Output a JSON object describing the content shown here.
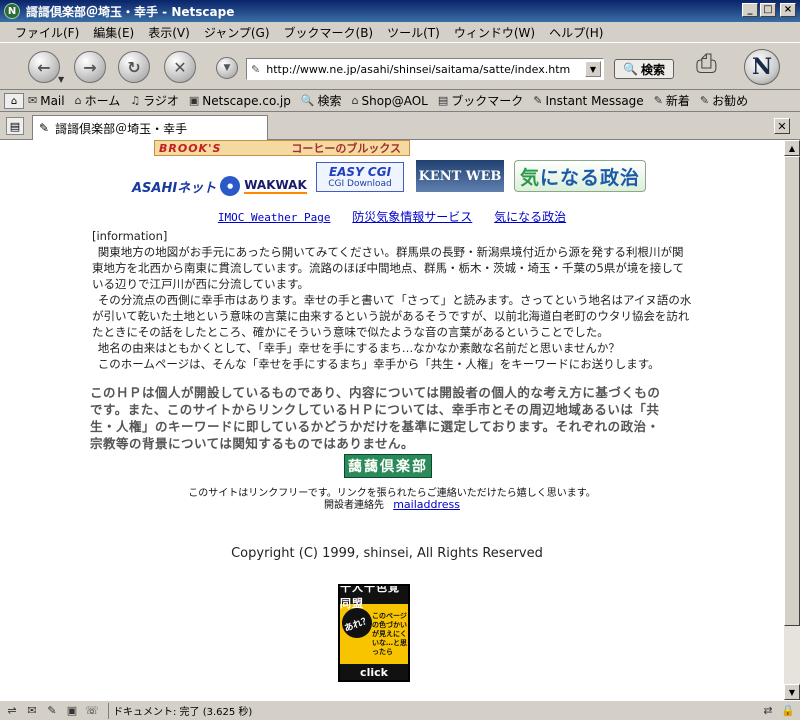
{
  "window": {
    "title": "謌謌倶楽部＠埼玉・幸手 - Netscape",
    "app_icon": "N",
    "minimize": "_",
    "maximize": "□",
    "close": "×"
  },
  "menu": [
    "ファイル(F)",
    "編集(E)",
    "表示(V)",
    "ジャンプ(G)",
    "ブックマーク(B)",
    "ツール(T)",
    "ウィンドウ(W)",
    "ヘルプ(H)"
  ],
  "nav": {
    "url": "http://www.ne.jp/asahi/shinsei/saitama/satte/index.htm",
    "search_label": "検索"
  },
  "personal_toolbar": [
    {
      "icon": "✉",
      "label": "Mail"
    },
    {
      "icon": "⌂",
      "label": "ホーム"
    },
    {
      "icon": "♫",
      "label": "ラジオ"
    },
    {
      "icon": "▣",
      "label": "Netscape.co.jp"
    },
    {
      "icon": "🔍",
      "label": "検索"
    },
    {
      "icon": "⌂",
      "label": "Shop@AOL"
    },
    {
      "icon": "▤",
      "label": "ブックマーク"
    },
    {
      "icon": "✎",
      "label": "Instant Message"
    },
    {
      "icon": "✎",
      "label": "新着"
    },
    {
      "icon": "✎",
      "label": "お勧め"
    }
  ],
  "tab": {
    "label": "謌謌倶楽部＠埼玉・幸手"
  },
  "page": {
    "top_banner_brand": "BROOK'S",
    "top_banner_text": "コーヒーのブルックス",
    "logo_asahi": "ASAHIネット",
    "logo_wakwak": "WAKWAK",
    "badge_easy_cgi": "EASY CGI",
    "badge_easy_cgi_sub": "CGI Download",
    "badge_kent": "KENT WEB",
    "badge_kininaru_kana": "気",
    "badge_kininaru_rest": "になる政治",
    "links": [
      "IMOC Weather Page",
      "防災気象情報サービス",
      "気になる政治"
    ],
    "info_head": "[information]",
    "info_paragraphs": [
      "関東地方の地図がお手元にあったら開いてみてください。群馬県の長野・新潟県境付近から源を発する利根川が関東地方を北西から南東に貫流しています。流路のほぼ中間地点、群馬・栃木・茨城・埼玉・千葉の5県が境を接している辺りで江戸川が西に分流しています。",
      "その分流点の西側に幸手市はあります。幸せの手と書いて「さって」と読みます。さってという地名はアイヌ語の水が引いて乾いた土地という意味の言葉に由来するという説があるそうですが、以前北海道白老町のウタリ協会を訪れたときにその話をしたところ、確かにそういう意味で似たような音の言葉があるということでした。",
      "地名の由来はともかくとして、「幸手」幸せを手にするまち…なかなか素敵な名前だと思いませんか？",
      "このホームページは、そんな「幸せを手にするまち」幸手から「共生・人権」をキーワードにお送りします。"
    ],
    "disclaimer": "このＨＰは個人が開設しているものであり、内容については開設者の個人的な考え方に基づくものです。また、このサイトからリンクしているＨＰについては、幸手市とその周辺地域あるいは「共生・人権」のキーワードに即しているかどうかだけを基準に選定しております。それぞれの政治・宗教等の背景については関知するものではありません。",
    "club_badge": "藹藹倶楽部",
    "linkfree": "このサイトはリンクフリーです。リンクを張られたらご連絡いただけたら嬉しく思います。",
    "contact_label": "開設者連絡先",
    "contact_link": "mailaddress",
    "copyright": "Copyright (C) 1999, shinsei, All Rights Reserved",
    "bottom_banner_top": "十人十色覚同盟",
    "bottom_banner_ball": "あれ？",
    "bottom_banner_text": "このページの色づかいが見えにくいな…と思ったら",
    "bottom_banner_click": "click"
  },
  "status": {
    "text": "ドキュメント: 完了 (3.625 秒)"
  }
}
